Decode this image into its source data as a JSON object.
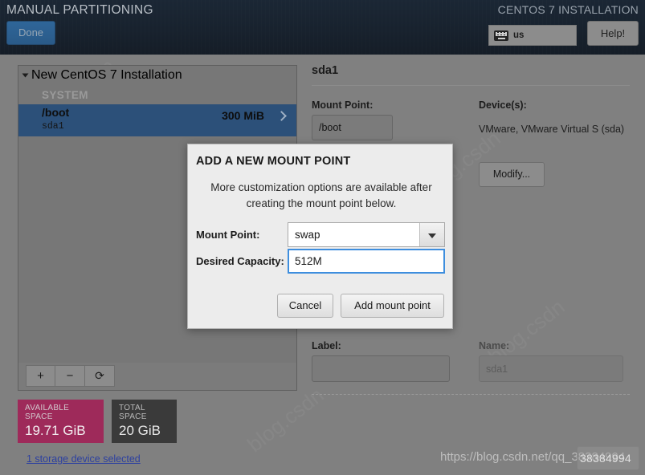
{
  "header": {
    "title": "MANUAL PARTITIONING",
    "product_title": "CENTOS 7 INSTALLATION",
    "done_label": "Done",
    "help_label": "Help!",
    "keyboard_layout": "us",
    "keyboard_icon": "keyboard-icon"
  },
  "left_panel": {
    "tree_header": "New CentOS 7 Installation",
    "group_label": "SYSTEM",
    "partitions": [
      {
        "mount": "/boot",
        "device": "sda1",
        "size": "300 MiB",
        "selected": true
      }
    ],
    "toolbar": {
      "add_label": "+",
      "remove_label": "−",
      "refresh_label": "⟳"
    }
  },
  "space_summary": {
    "available": {
      "caption": "AVAILABLE SPACE",
      "value": "19.71 GiB",
      "color": "#9e2a5a"
    },
    "total": {
      "caption": "TOTAL SPACE",
      "value": "20 GiB",
      "color": "#3a3a3a"
    },
    "storage_link": "1 storage device selected"
  },
  "detail_panel": {
    "title": "sda1",
    "mount_point_label": "Mount Point:",
    "mount_point_value": "/boot",
    "devices_label": "Device(s):",
    "devices_value": "VMware, VMware Virtual S (sda)",
    "modify_label": "Modify...",
    "label_label": "Label:",
    "label_value": "",
    "name_label": "Name:",
    "name_value": "sda1"
  },
  "dialog": {
    "title": "ADD A NEW MOUNT POINT",
    "description": "More customization options are available after creating the mount point below.",
    "mount_point_label": "Mount Point:",
    "mount_point_value": "swap",
    "desired_capacity_label": "Desired Capacity:",
    "desired_capacity_value": "512M",
    "cancel_label": "Cancel",
    "add_label": "Add mount point",
    "focus_color": "#3e8ede"
  },
  "watermark": {
    "url": "https://blog.csdn.net/qq_38384994",
    "overlay_number": "38384994"
  }
}
